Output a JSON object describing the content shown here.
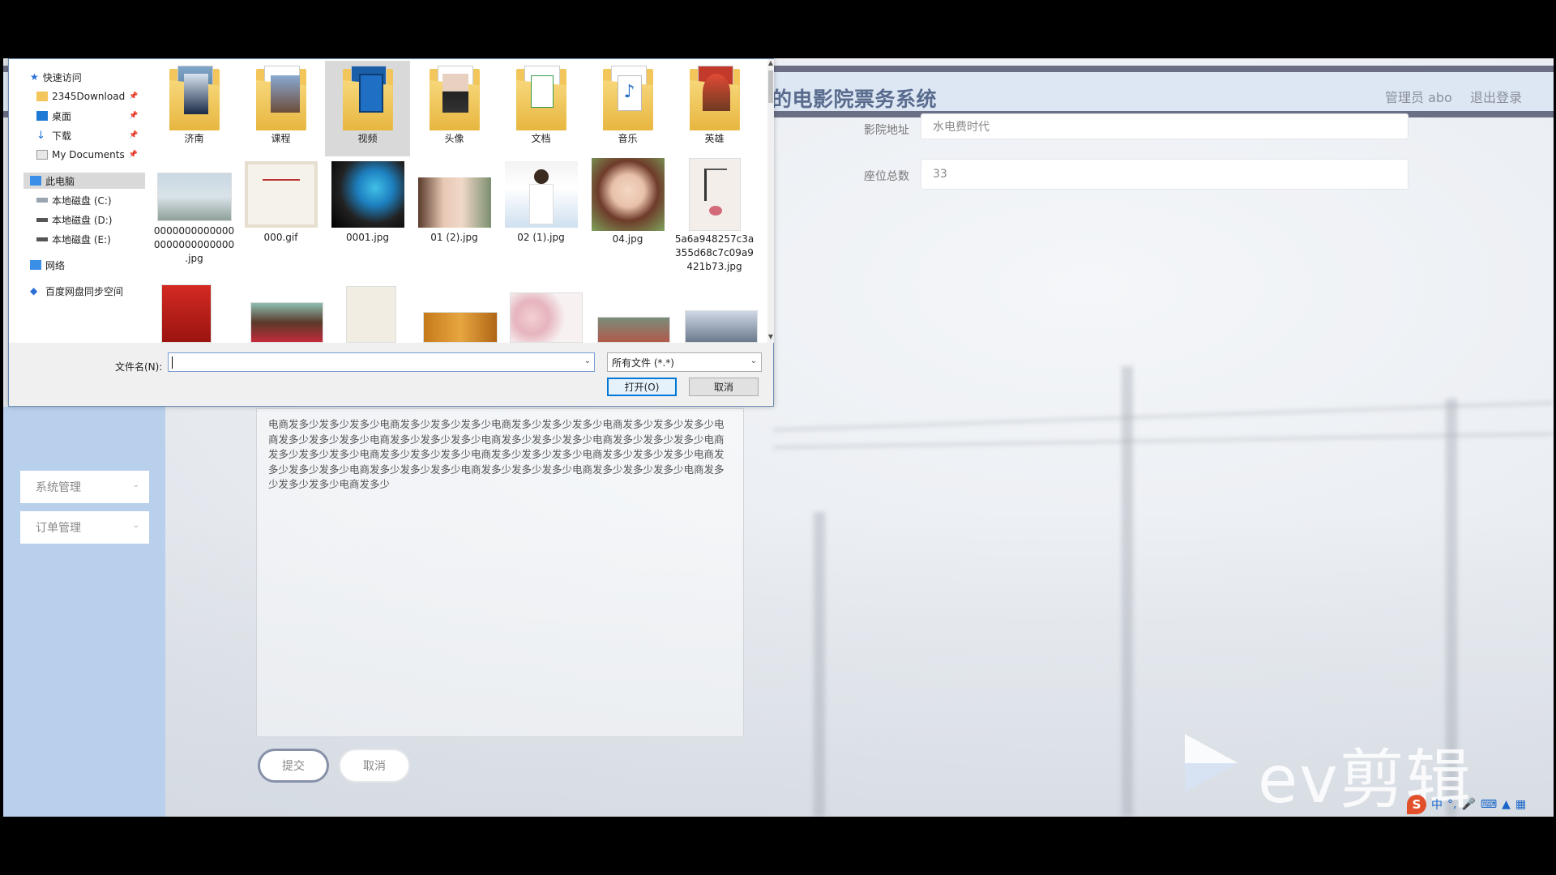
{
  "app": {
    "title": "的电影院票务系统",
    "admin_label": "管理员 abo",
    "logout_label": "退出登录"
  },
  "form": {
    "address_label": "影院地址",
    "address_value": "水电费时代",
    "seats_label": "座位总数",
    "seats_value": "33",
    "description": "电商发多少发多少发多少电商发多少发多少发多少电商发多少发多少发多少电商发多少发多少发多少电商发多少发多少发多少电商发多少发多少发多少电商发多少发多少发多少电商发多少发多少发多少电商发多少发多少发多少电商发多少发多少发多少电商发多少发多少发多少电商发多少发多少发多少电商发多少发多少发多少电商发多少发多少发多少电商发多少发多少发多少电商发多少发多少发多少电商发多少发多少发多少电商发多少",
    "submit_label": "提交",
    "cancel_label": "取消"
  },
  "sidebar": {
    "items": [
      {
        "label": "系统管理"
      },
      {
        "label": "订单管理"
      }
    ]
  },
  "dialog": {
    "nav": [
      {
        "label": "快速访问",
        "icon": "star-icon"
      },
      {
        "label": "2345Download",
        "icon": "folder-icon",
        "pinned": true
      },
      {
        "label": "桌面",
        "icon": "desktop-icon",
        "pinned": true
      },
      {
        "label": "下载",
        "icon": "download-icon",
        "pinned": true
      },
      {
        "label": "My Documents",
        "icon": "document-icon",
        "pinned": true
      },
      {
        "label": "此电脑",
        "icon": "computer-icon",
        "selected": true
      },
      {
        "label": "本地磁盘 (C:)",
        "icon": "drive-icon"
      },
      {
        "label": "本地磁盘 (D:)",
        "icon": "drive-icon"
      },
      {
        "label": "本地磁盘 (E:)",
        "icon": "drive-icon"
      },
      {
        "label": "网络",
        "icon": "network-icon"
      },
      {
        "label": "百度网盘同步空间",
        "icon": "cloud-icon"
      }
    ],
    "folders": [
      {
        "label": "济南"
      },
      {
        "label": "课程"
      },
      {
        "label": "视频",
        "selected": true
      },
      {
        "label": "头像"
      },
      {
        "label": "文档"
      },
      {
        "label": "音乐"
      },
      {
        "label": "英雄"
      }
    ],
    "files": [
      {
        "label": "0000000000000 0000000000000 .jpg"
      },
      {
        "label": "000.gif"
      },
      {
        "label": "0001.jpg"
      },
      {
        "label": "01 (2).jpg"
      },
      {
        "label": "02 (1).jpg"
      },
      {
        "label": "04.jpg"
      },
      {
        "label": "5a6a948257c3a 355d68c7c09a9 421b73.jpg"
      }
    ],
    "filename_label": "文件名(N):",
    "filename_value": "",
    "filetype_value": "所有文件 (*.*)",
    "open_label": "打开(O)",
    "cancel_label": "取消"
  },
  "ime": {
    "mode": "中"
  },
  "watermark": {
    "text": "ev剪辑"
  }
}
